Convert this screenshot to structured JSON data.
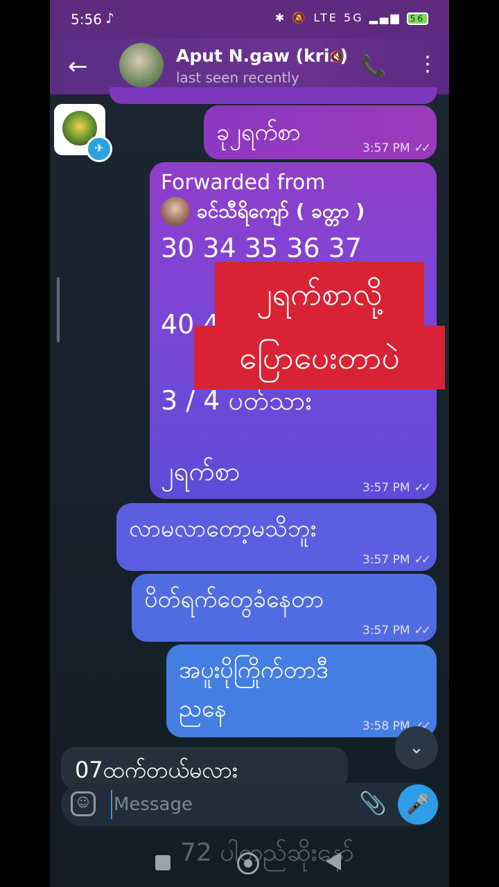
{
  "status_bar": {
    "time": "5:56",
    "tiktok_icon": "♪",
    "signal_icons": "✱ 🔕 LTE 5G ▂▄▆",
    "battery": "56"
  },
  "header": {
    "back_icon": "←",
    "contact_name": "Aput N.gaw (kris)",
    "mute_icon": "🔇",
    "last_seen": "last seen recently",
    "call_icon": "📞",
    "menu_icon": "⋮"
  },
  "messages": [
    {
      "text": "ခု၂ရက်စာ",
      "time": "3:57 PM"
    },
    {
      "forwarded_label": "Forwarded from",
      "forwarded_name": "ခင်သီရိကျော် ( ခတ္တာ )",
      "lines": [
        "30 34 35 36 37",
        "40 4",
        "3 / 4 ပတ်သား",
        "၂ရက်စာ"
      ],
      "time": "3:57 PM"
    },
    {
      "text": "လာမလာတော့မသိဘူး",
      "time": "3:57 PM"
    },
    {
      "text": "ပိတ်ရက်တွေခံနေတာ",
      "time": "3:57 PM"
    },
    {
      "lines": [
        "အပူးပိုကြိုက်တာဒီ",
        "ညနေ"
      ],
      "time": "3:58 PM"
    }
  ],
  "check_icon": "✓✓",
  "overlay": {
    "line1": "၂ရက်စာလို့",
    "line2": "ပြောပေးတာပဲ"
  },
  "received_partial": "07ထက်တယ်မလား",
  "scroll_down_icon": "⌄",
  "input": {
    "placeholder": "Message",
    "emoji_icon": "☺",
    "attach_icon": "📎",
    "mic_icon": "🎤"
  },
  "ghost_text": "72 ပါတည်ဆိုးနော်",
  "telegram_icon": "✈"
}
